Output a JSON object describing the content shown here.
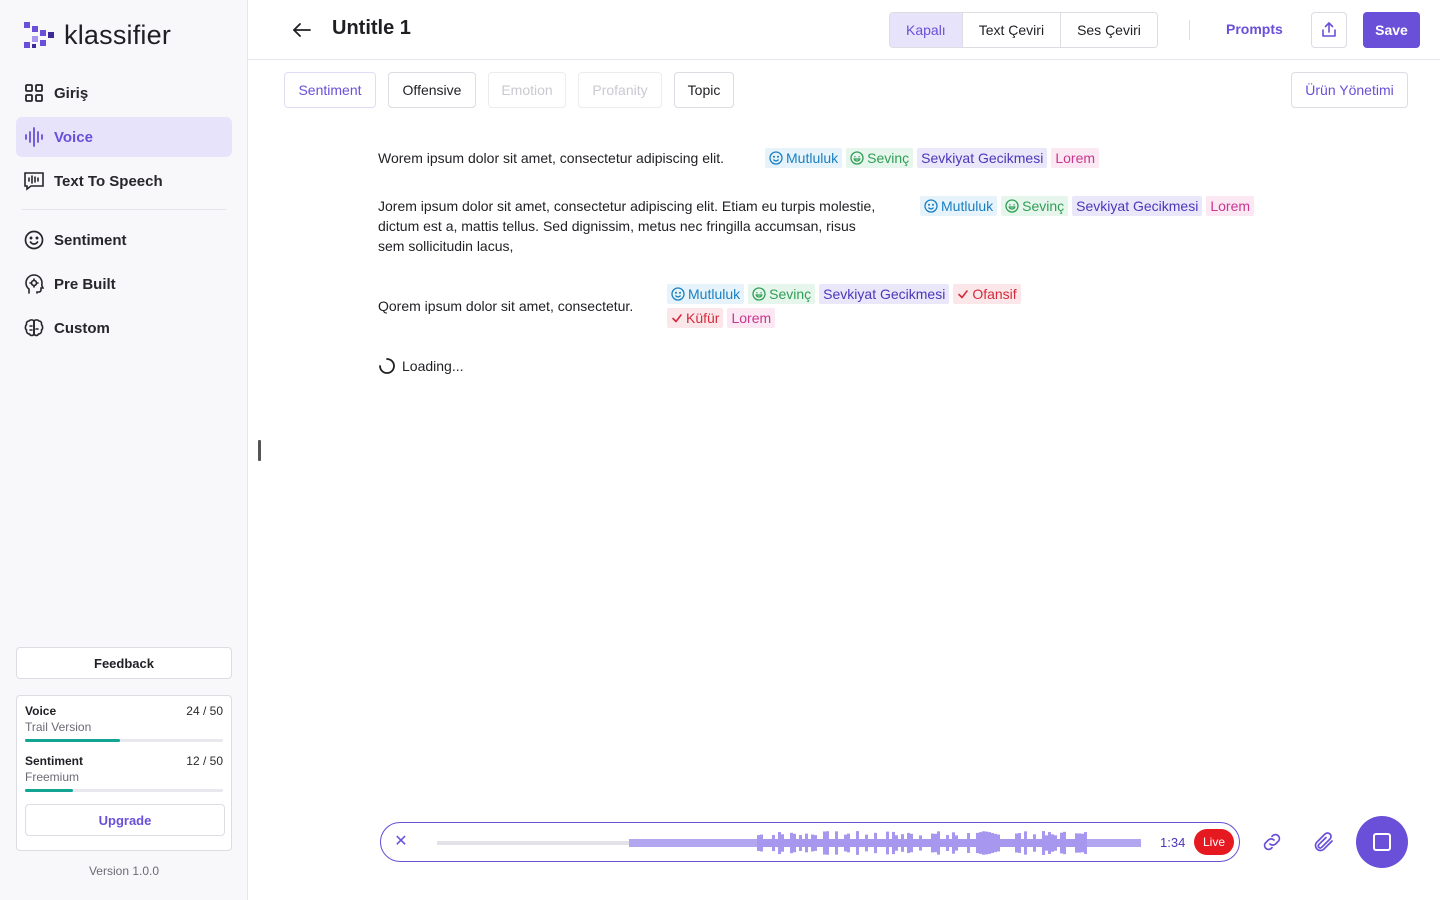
{
  "app": {
    "name": "klassifier",
    "version": "Version 1.0.0"
  },
  "sidebar": {
    "items": [
      {
        "label": "Giriş",
        "icon": "grid-icon"
      },
      {
        "label": "Voice",
        "icon": "waveform-icon",
        "active": true
      },
      {
        "label": "Text To Speech",
        "icon": "speech-bubble-icon"
      },
      {
        "label": "Sentiment",
        "icon": "smiley-icon"
      },
      {
        "label": "Pre Built",
        "icon": "brain-head-icon"
      },
      {
        "label": "Custom",
        "icon": "brain-icon"
      }
    ],
    "feedback_label": "Feedback",
    "usage": [
      {
        "title": "Voice",
        "plan": "Trail Version",
        "count": "24 / 50",
        "progress": 0.48
      },
      {
        "title": "Sentiment",
        "plan": "Freemium",
        "count": "12 / 50",
        "progress": 0.24
      }
    ],
    "upgrade_label": "Upgrade"
  },
  "header": {
    "title": "Untitle 1",
    "modes": [
      "Kapalı",
      "Text Çeviri",
      "Ses Çeviri"
    ],
    "active_mode": "Kapalı",
    "prompts_label": "Prompts",
    "save_label": "Save"
  },
  "filters": {
    "items": [
      {
        "label": "Sentiment",
        "state": "active"
      },
      {
        "label": "Offensive",
        "state": "normal"
      },
      {
        "label": "Emotion",
        "state": "disabled"
      },
      {
        "label": "Profanity",
        "state": "disabled"
      },
      {
        "label": "Topic",
        "state": "normal"
      }
    ],
    "product_management_label": "Ürün Yönetimi"
  },
  "transcript": [
    {
      "text": "Worem ipsum dolor sit amet, consectetur adipiscing elit.",
      "tags": [
        {
          "label": "Mutluluk",
          "color": "blue",
          "icon": "smiley-icon"
        },
        {
          "label": "Sevinç",
          "color": "green",
          "icon": "grin-icon"
        },
        {
          "label": "Sevkiyat Gecikmesi",
          "color": "purple"
        },
        {
          "label": "Lorem",
          "color": "pink"
        }
      ]
    },
    {
      "text": "Jorem ipsum dolor sit amet, consectetur adipiscing elit. Etiam eu turpis molestie, dictum est a, mattis tellus. Sed dignissim, metus nec fringilla accumsan, risus sem sollicitudin lacus,",
      "tags": [
        {
          "label": "Mutluluk",
          "color": "blue",
          "icon": "smiley-icon"
        },
        {
          "label": "Sevinç",
          "color": "green",
          "icon": "grin-icon"
        },
        {
          "label": "Sevkiyat Gecikmesi",
          "color": "purple"
        },
        {
          "label": "Lorem",
          "color": "pink"
        }
      ]
    },
    {
      "text": "Qorem ipsum dolor sit amet, consectetur.",
      "tags": [
        {
          "label": "Mutluluk",
          "color": "blue",
          "icon": "smiley-icon"
        },
        {
          "label": "Sevinç",
          "color": "green",
          "icon": "grin-icon"
        },
        {
          "label": "Sevkiyat Gecikmesi",
          "color": "purple"
        },
        {
          "label": "Ofansif",
          "color": "red",
          "icon": "check-icon"
        },
        {
          "label": "Küfür",
          "color": "red",
          "icon": "check-icon"
        },
        {
          "label": "Lorem",
          "color": "pink"
        }
      ]
    }
  ],
  "loading_label": "Loading...",
  "player": {
    "time": "1:34",
    "live_label": "Live"
  },
  "colors": {
    "accent": "#6a4fd8",
    "accent_soft": "#e7e3fb",
    "progress": "#12a594",
    "live": "#e5191f"
  }
}
